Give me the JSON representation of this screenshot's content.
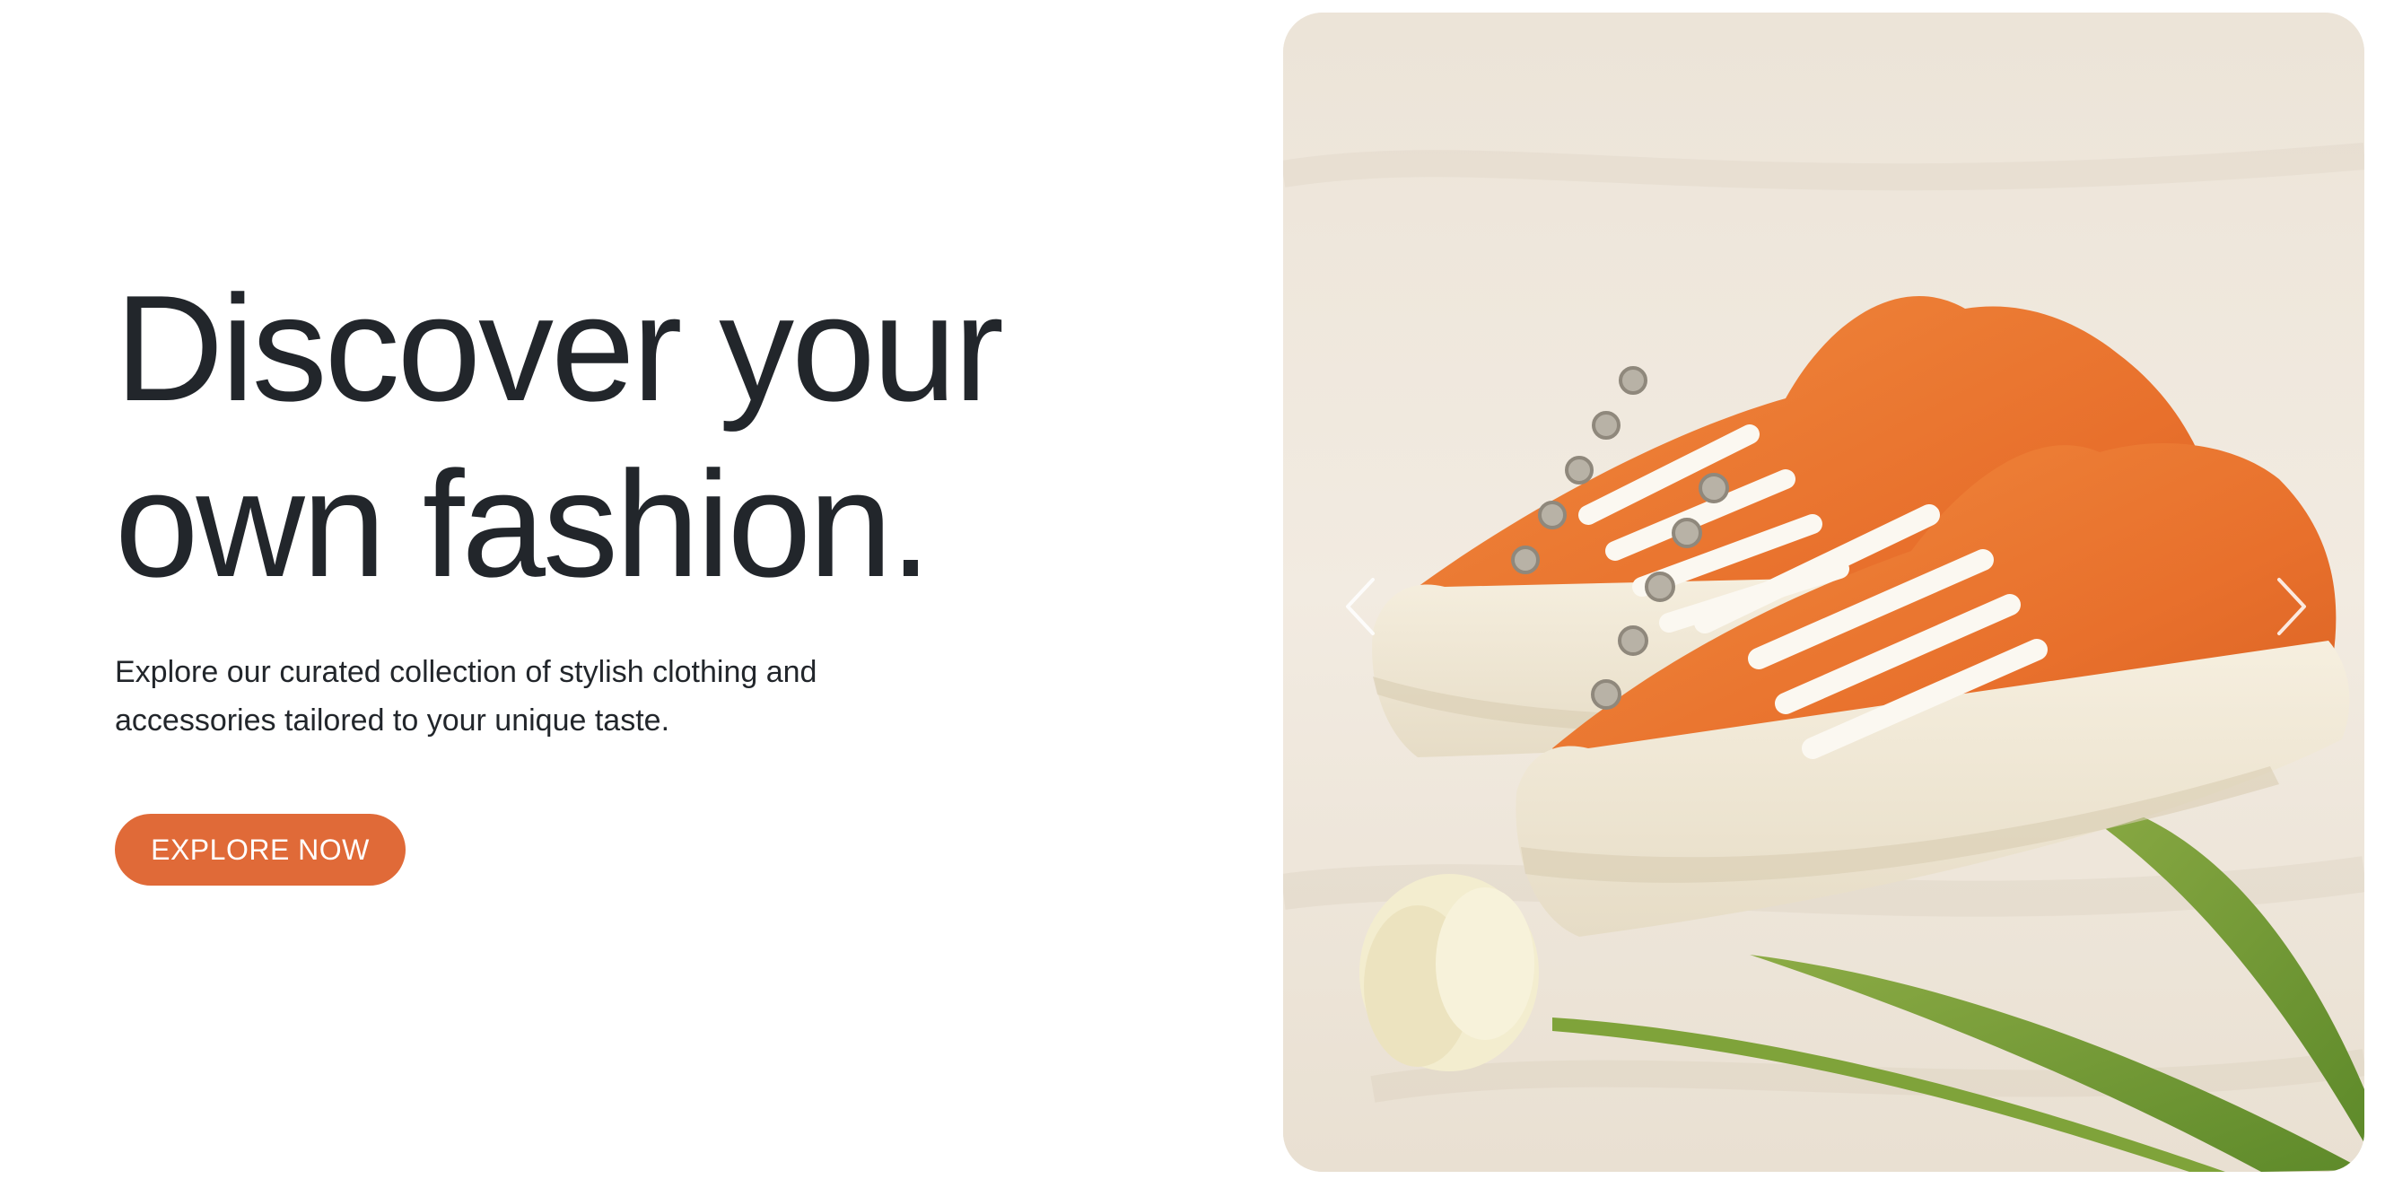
{
  "hero": {
    "headline_line1": "Discover your",
    "headline_line2": "own fashion.",
    "description_line1": "Explore our curated collection of stylish clothing and",
    "description_line2": "accessories tailored to your unique taste.",
    "cta_label": "EXPLORE NOW"
  },
  "carousel": {
    "image_alt": "Orange canvas sneakers with a white tulip",
    "prev_icon": "chevron-left-icon",
    "next_icon": "chevron-right-icon"
  },
  "colors": {
    "accent": "#e06a38",
    "text": "#22262b",
    "background": "#ffffff"
  }
}
